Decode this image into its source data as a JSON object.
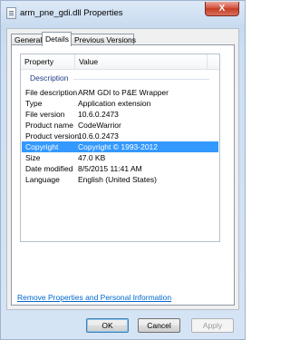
{
  "window": {
    "title": "arm_pne_gdi.dll Properties",
    "close_glyph": "X"
  },
  "tabs": [
    {
      "label": "General",
      "active": false
    },
    {
      "label": "Details",
      "active": true
    },
    {
      "label": "Previous Versions",
      "active": false
    }
  ],
  "details": {
    "columns": {
      "property": "Property",
      "value": "Value"
    },
    "group": "Description",
    "rows": [
      {
        "property": "File description",
        "value": "ARM GDI to P&E Wrapper"
      },
      {
        "property": "Type",
        "value": "Application extension"
      },
      {
        "property": "File version",
        "value": "10.6.0.2473"
      },
      {
        "property": "Product name",
        "value": "CodeWarrior"
      },
      {
        "property": "Product version",
        "value": "10.6.0.2473"
      },
      {
        "property": "Copyright",
        "value": "Copyright © 1993-2012"
      },
      {
        "property": "Size",
        "value": "47.0 KB"
      },
      {
        "property": "Date modified",
        "value": "8/5/2015 11:41 AM"
      },
      {
        "property": "Language",
        "value": "English (United States)"
      }
    ],
    "selected_row": "Copyright"
  },
  "remove_link": "Remove Properties and Personal Information",
  "buttons": {
    "ok": "OK",
    "cancel": "Cancel",
    "apply": "Apply"
  },
  "colors": {
    "selection": "#3399ff",
    "link": "#0066cc",
    "group_label": "#1e3d87"
  },
  "icons": {
    "title_icon": "dll-file-icon",
    "close": "close-icon"
  }
}
